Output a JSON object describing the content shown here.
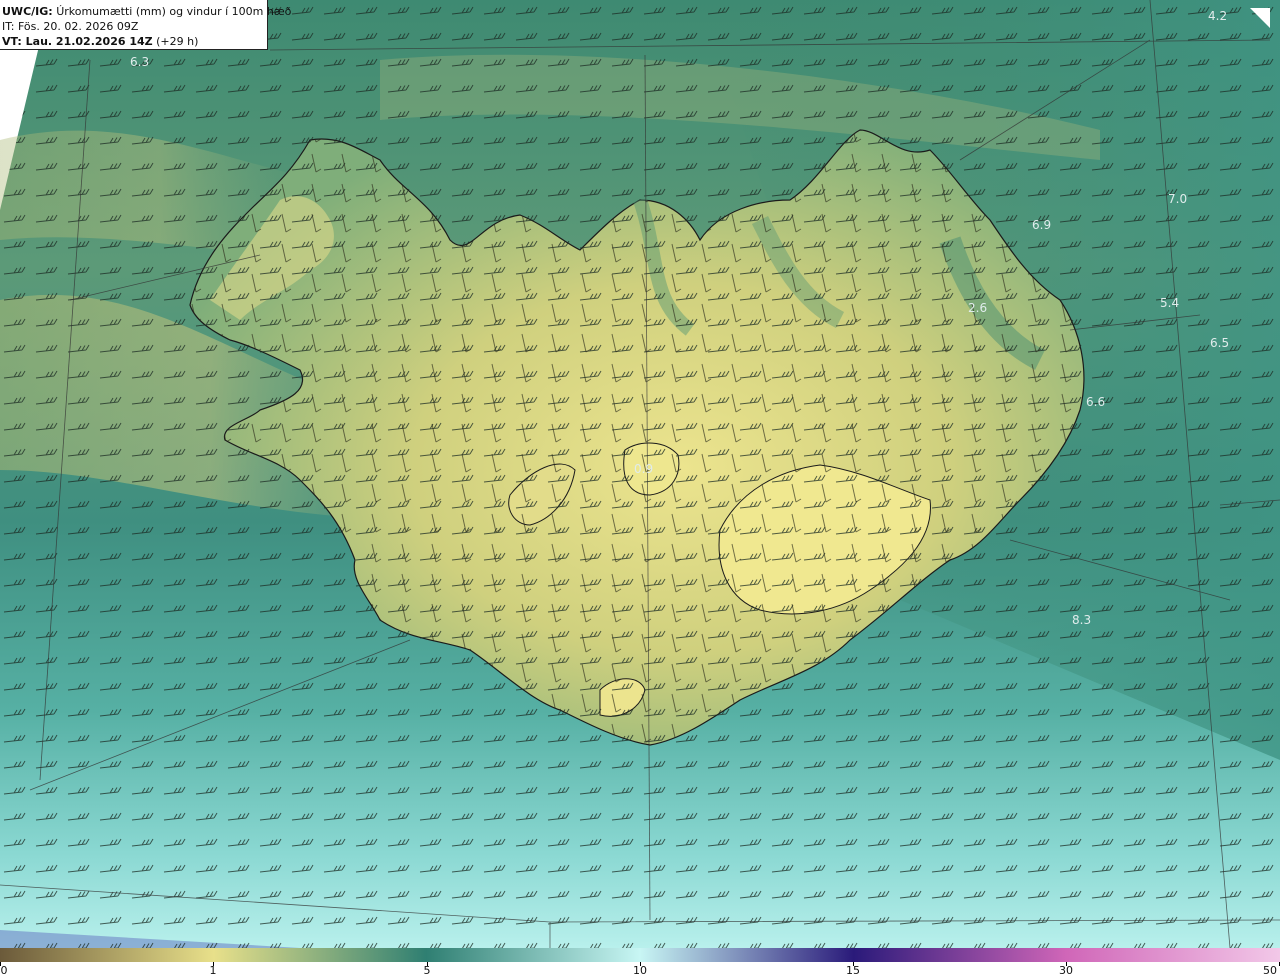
{
  "title": {
    "product_bold": "UWC/IG:",
    "product_text": "Úrkomumætti (mm) og vindur í 100m hæð",
    "it_line": "IT: Fös. 20. 02. 2026 09Z",
    "vt_bold": "VT: Lau. 21.02.2026 14Z",
    "vt_offset": "(+29 h)"
  },
  "value_labels": [
    "6.3",
    "4.2",
    "7.0",
    "6.9",
    "5.4",
    "6.5",
    "2.6",
    "6.6",
    "0.9",
    "8.3"
  ],
  "colorbar": {
    "ticks": [
      "0",
      "1",
      "5",
      "10",
      "15",
      "30",
      "50"
    ],
    "colors": {
      "c0": "#6b5a3a",
      "c1": "#e8e08a",
      "c5": "#2f7f72",
      "c10": "#c8f6f4",
      "c15": "#2a1a7a",
      "c30": "#d066b8",
      "c50": "#f2c8e8"
    }
  },
  "field_colors": {
    "land_dry": "#e9e28c",
    "land_mid": "#b7c477",
    "sea_green": "#3f8a74",
    "sea_teal": "#4fa79a",
    "sea_light": "#8fe0dc"
  }
}
